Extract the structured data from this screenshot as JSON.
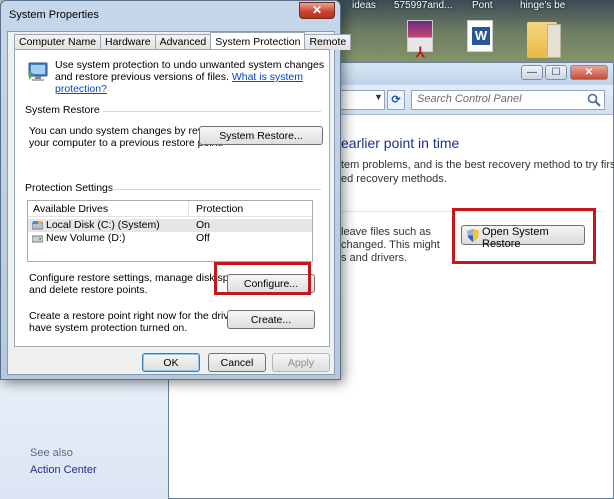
{
  "desktop": {
    "labels": [
      "ideas",
      "575997and...",
      "Pont",
      "hinge's be"
    ],
    "icon_names": [
      "pdf-file-icon",
      "word-document-icon",
      "folder-icon"
    ]
  },
  "control_panel": {
    "search_placeholder": "Search Control Panel",
    "heading": "earlier point in time",
    "intro_lines": [
      "tem problems, and is the best recovery method to try first.",
      "ed recovery methods."
    ],
    "restore_text_lines": [
      "leave files such as",
      "changed. This might",
      "s and drivers."
    ],
    "open_system_restore_button": "Open System Restore",
    "see_also": "See also",
    "action_center": "Action Center"
  },
  "dialog": {
    "title": "System Properties",
    "close_label": "✕",
    "tabs": [
      {
        "label": "Computer Name",
        "active": false
      },
      {
        "label": "Hardware",
        "active": false
      },
      {
        "label": "Advanced",
        "active": false
      },
      {
        "label": "System Protection",
        "active": true
      },
      {
        "label": "Remote",
        "active": false
      }
    ],
    "intro_text": "Use system protection to undo unwanted system changes and restore previous versions of files.",
    "intro_link": "What is system protection?",
    "system_restore": {
      "label": "System Restore",
      "text_line1": "You can undo system changes by reverting",
      "text_line2": "your computer to a previous restore point.",
      "button": "System Restore..."
    },
    "protection_settings": {
      "label": "Protection Settings",
      "columns": [
        "Available Drives",
        "Protection"
      ],
      "drives": [
        {
          "name": "Local Disk (C:) (System)",
          "protection": "On",
          "selected": true
        },
        {
          "name": "New Volume (D:)",
          "protection": "Off",
          "selected": false
        }
      ],
      "configure_text_line1": "Configure restore settings, manage disk space,",
      "configure_text_line2": "and delete restore points.",
      "configure_button": "Configure...",
      "create_text_line1": "Create a restore point right now for the drives that",
      "create_text_line2": "have system protection turned on.",
      "create_button": "Create..."
    },
    "footer": {
      "ok": "OK",
      "cancel": "Cancel",
      "apply": "Apply"
    }
  },
  "colors": {
    "highlight": "#c4161c",
    "link": "#0645c6",
    "heading_blue": "#1e3287"
  }
}
